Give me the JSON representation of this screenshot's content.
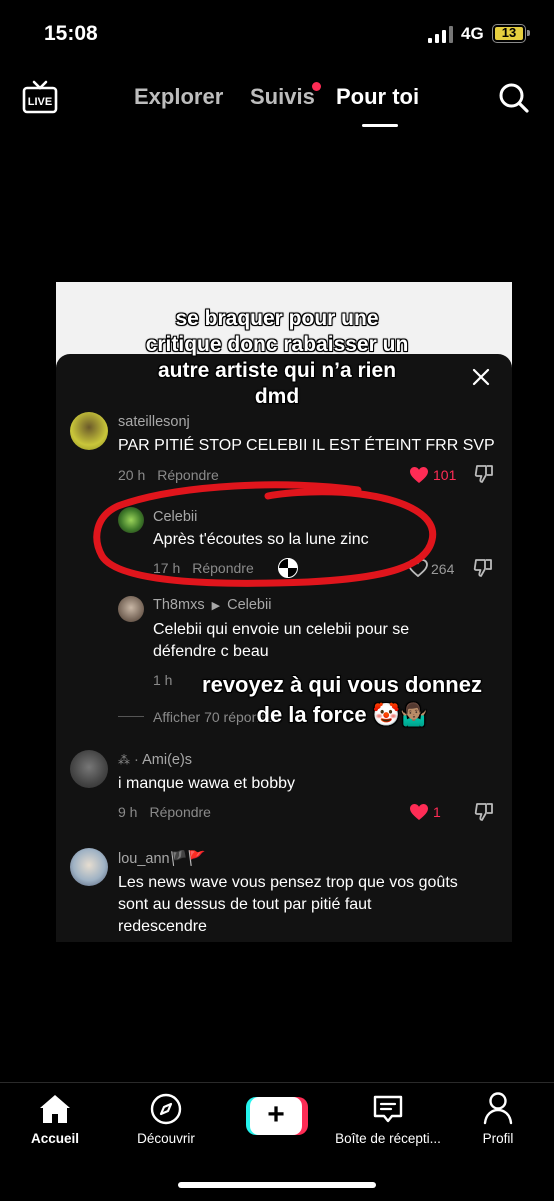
{
  "status_bar": {
    "time": "15:08",
    "network": "4G",
    "battery": "13"
  },
  "top_nav": {
    "live_label": "LIVE",
    "tabs": [
      "Explorer",
      "Suivis",
      "Pour toi"
    ],
    "active_tab": "Pour toi"
  },
  "captions": {
    "top_line1": "se braquer pour une",
    "top_line2": "critique donc rabaisser un",
    "top_line3": "autre artiste qui n’a rien",
    "top_line4": "dmd",
    "bottom_line1": "revoyez à qui vous donnez",
    "bottom_line2": "de la force 🤡🤷🏽‍♂️"
  },
  "comments": [
    {
      "username": "sateillesonj",
      "text": "PAR PITIÉ STOP CELEBII IL EST ÉTEINT FRR SVP",
      "time": "20 h",
      "reply_label": "Répondre",
      "likes": "101",
      "liked": true
    },
    {
      "username": "Celebii",
      "text": "Après t'écoutes so la lune zinc",
      "time": "17 h",
      "reply_label": "Répondre",
      "likes": "264",
      "liked": false
    },
    {
      "username": "Th8mxs",
      "reply_to": "Celebii",
      "text_line1": "Celebii qui envoie un celebii pour se",
      "text_line2": "défendre c beau",
      "time": "1 h"
    },
    {
      "view_more": "Afficher 70 réponses"
    },
    {
      "username": "Ami(e)s",
      "text": "i manque wawa et bobby",
      "time": "9 h",
      "reply_label": "Répondre",
      "likes": "1",
      "liked": true
    },
    {
      "username": "lou_ann🏴🚩",
      "text_line1": "Les news wave vous pensez trop que vos goûts",
      "text_line2": "sont au dessus de tout par pitié faut",
      "text_line3": "redescendre"
    }
  ],
  "bottom_nav": {
    "items": [
      "Accueil",
      "Découvrir",
      "",
      "Boîte de récepti...",
      "Profil"
    ],
    "create_label": "+"
  },
  "colors": {
    "accent_red": "#fe2c55",
    "scribble_red": "#e0151c"
  }
}
